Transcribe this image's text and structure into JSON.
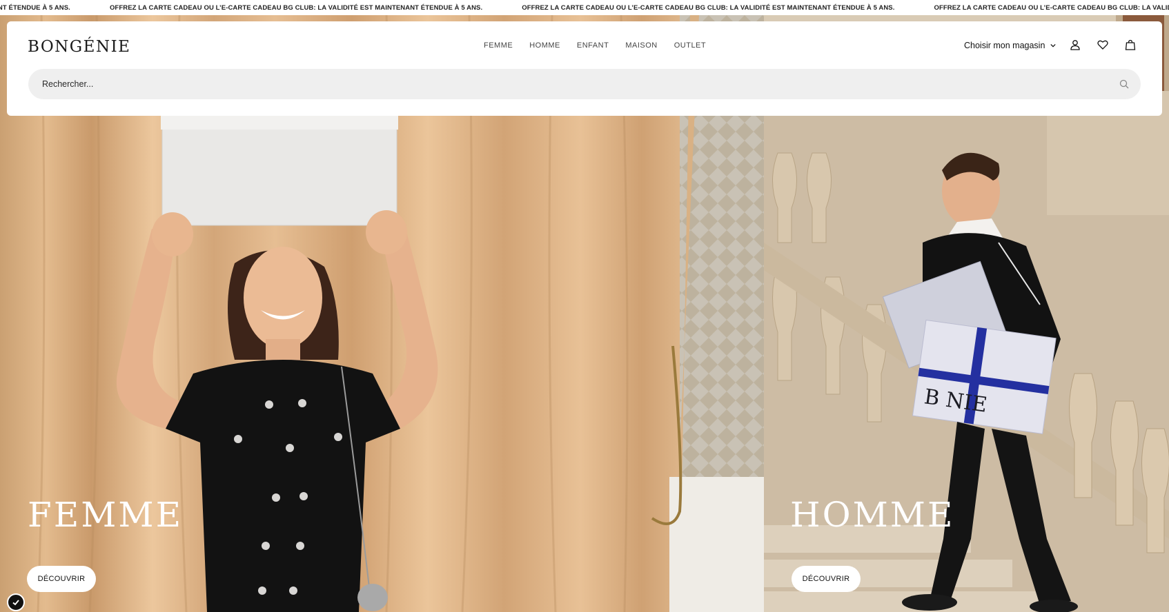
{
  "announcement": {
    "text_repeat": "OFFREZ LA CARTE CADEAU OU L’E-CARTE CADEAU BG CLUB: LA VALIDITÉ EST MAINTENANT ÉTENDUE À 5 ANS.",
    "text_partial": "AINTENANT ÉTENDUE À 5 ANS."
  },
  "header": {
    "logo": "BONGÉNIE",
    "nav": [
      "FEMME",
      "HOMME",
      "ENFANT",
      "MAISON",
      "OUTLET"
    ],
    "store_select": "Choisir mon magasin",
    "icons": [
      "account-icon",
      "heart-icon",
      "shopping-bag-icon"
    ],
    "search": {
      "placeholder": "Rechercher..."
    }
  },
  "hero": {
    "panels": [
      {
        "title": "FEMME",
        "cta": "DÉCOUVRIR"
      },
      {
        "title": "HOMME",
        "cta": "DÉCOUVRIR"
      }
    ]
  },
  "colors": {
    "curtain": "#d8aa7c",
    "stone": "#cfbfa8",
    "dress": "#121212",
    "ribbon": "#2430a0",
    "search_bg": "#efefef"
  }
}
